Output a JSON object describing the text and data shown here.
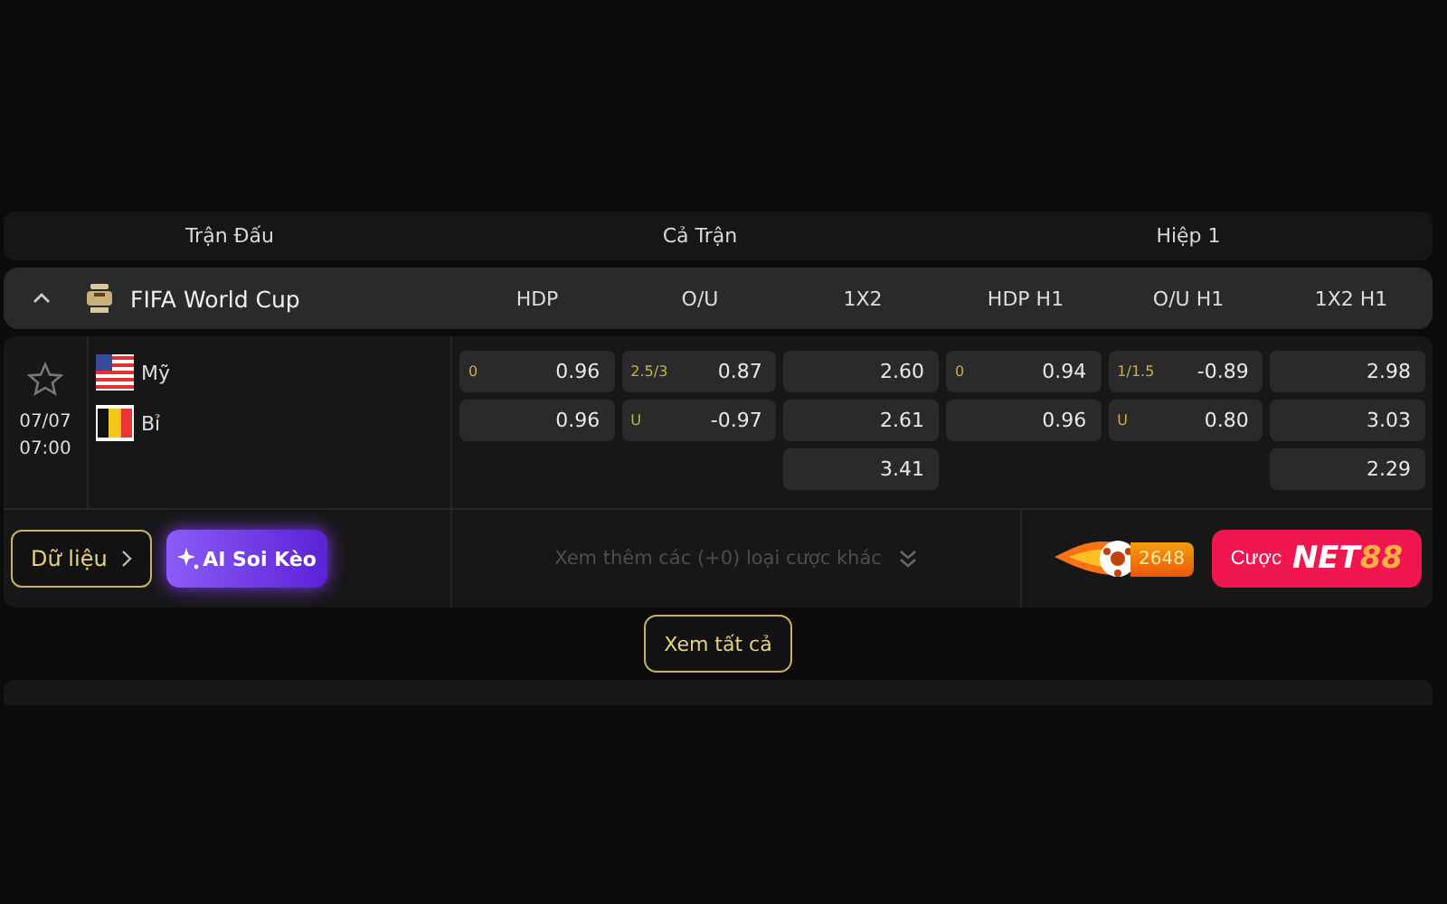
{
  "header": [
    "Trận Đấu",
    "Cả Trận",
    "Hiệp 1"
  ],
  "league": {
    "name": "FIFA World Cup",
    "expanded": true,
    "columns": [
      "HDP",
      "O/U",
      "1X2",
      "HDP H1",
      "O/U H1",
      "1X2 H1"
    ]
  },
  "match": {
    "favorite": false,
    "date": "07/07",
    "time": "07:00",
    "teams": [
      {
        "name": "Mỹ",
        "kind": "us"
      },
      {
        "name": "Bỉ",
        "kind": "be"
      }
    ],
    "markets": [
      {
        "cells": [
          {
            "line": "0",
            "odds": "0.96"
          },
          {
            "odds": "0.96"
          }
        ]
      },
      {
        "cells": [
          {
            "line": "2.5/3",
            "odds": "0.87"
          },
          {
            "line": "U",
            "odds": "-0.97"
          }
        ]
      },
      {
        "cells": [
          {
            "odds": "2.60"
          },
          {
            "odds": "2.61"
          },
          {
            "odds": "3.41"
          }
        ]
      },
      {
        "cells": [
          {
            "line": "0",
            "odds": "0.94"
          },
          {
            "odds": "0.96"
          }
        ]
      },
      {
        "cells": [
          {
            "line": "1/1.5",
            "odds": "-0.89"
          },
          {
            "line": "U",
            "odds": "0.80"
          }
        ]
      },
      {
        "cells": [
          {
            "odds": "2.98"
          },
          {
            "odds": "3.03"
          },
          {
            "odds": "2.29"
          }
        ]
      }
    ]
  },
  "actions": {
    "data_button": "Dữ liệu",
    "ai_button": "AI Soi Kèo",
    "more_bets": "Xem thêm các (+0) loại cược khác",
    "fire_count": "2648",
    "bet_label": "Cược",
    "bet_brand": "NET",
    "bet_brand_accent": "88"
  },
  "view_all": "Xem tất cả"
}
